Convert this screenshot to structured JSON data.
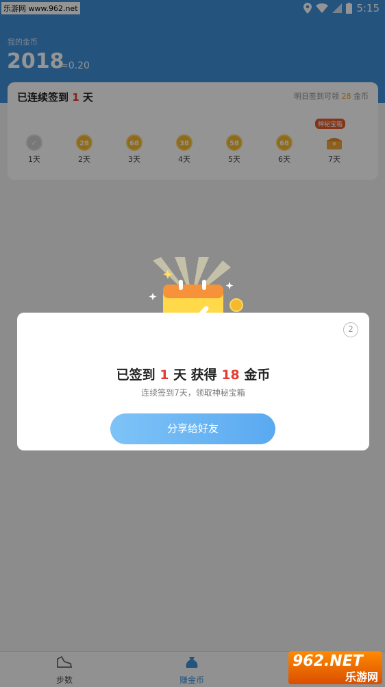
{
  "status_bar": {
    "watermark": "乐游网 www.962.net",
    "time": "5:15"
  },
  "header": {
    "coin_label": "我的金币",
    "coin_amount": "2018",
    "coin_approx": "≈0.20",
    "color": "#3f8fd9"
  },
  "checkin": {
    "streak_prefix": "已连续签到 ",
    "streak_days": "1",
    "streak_suffix": " 天",
    "tomorrow_prefix": "明日签到可领 ",
    "tomorrow_coins": "28",
    "tomorrow_suffix": " 金币",
    "mystery_tag": "神秘宝箱",
    "days": [
      {
        "coin": "",
        "label": "1天",
        "done": true
      },
      {
        "coin": "28",
        "label": "2天"
      },
      {
        "coin": "68",
        "label": "3天"
      },
      {
        "coin": "38",
        "label": "4天"
      },
      {
        "coin": "58",
        "label": "5天"
      },
      {
        "coin": "68",
        "label": "6天"
      },
      {
        "coin": "",
        "label": "7天",
        "chest": true
      }
    ]
  },
  "dialog": {
    "countdown": "2",
    "title_prefix": "已签到 ",
    "title_days": "1",
    "title_mid": " 天 获得 ",
    "title_coins": "18",
    "title_suffix": " 金币",
    "subtitle": "连续签到7天，领取神秘宝箱",
    "share_button": "分享给好友"
  },
  "bottom_nav": {
    "items": [
      {
        "label": "步数",
        "icon": "shoe-icon"
      },
      {
        "label": "赚金币",
        "icon": "coin-bag-icon",
        "active": true
      }
    ]
  },
  "watermark_bottom": {
    "number": "962.NET",
    "text": "乐游网"
  }
}
